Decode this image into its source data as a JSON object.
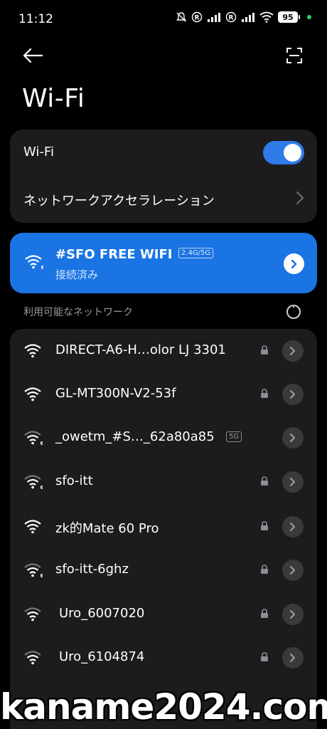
{
  "status_bar": {
    "time": "11:12",
    "battery": "95"
  },
  "header": {
    "title": "Wi-Fi"
  },
  "toggle_card": {
    "wifi_label": "Wi-Fi",
    "wifi_enabled": true,
    "accel_label": "ネットワークアクセラレーション"
  },
  "connected": {
    "ssid": "#SFO FREE WIFI",
    "band": "2.4G/5G",
    "status": "接続済み"
  },
  "available": {
    "label": "利用可能なネットワーク",
    "networks": [
      {
        "name": "DIRECT-A6-H…olor LJ 3301",
        "locked": true,
        "tag": ""
      },
      {
        "name": "GL-MT300N-V2-53f",
        "locked": true,
        "tag": ""
      },
      {
        "name": "_owetm_#S…_62a80a85",
        "locked": false,
        "tag": "5G"
      },
      {
        "name": "sfo-itt",
        "locked": true,
        "tag": ""
      },
      {
        "name": "zk的Mate 60 Pro",
        "locked": true,
        "tag": ""
      },
      {
        "name": "sfo-itt-6ghz",
        "locked": true,
        "tag": ""
      },
      {
        "name": "Uro_6007020",
        "locked": true,
        "tag": ""
      },
      {
        "name": "Uro_6104874",
        "locked": true,
        "tag": ""
      }
    ]
  },
  "watermark": "kaname2024.com",
  "colors": {
    "accent": "#1a74e3",
    "switch_on": "#2f7be8",
    "card_bg": "#1c1c1e",
    "background": "#000000"
  }
}
